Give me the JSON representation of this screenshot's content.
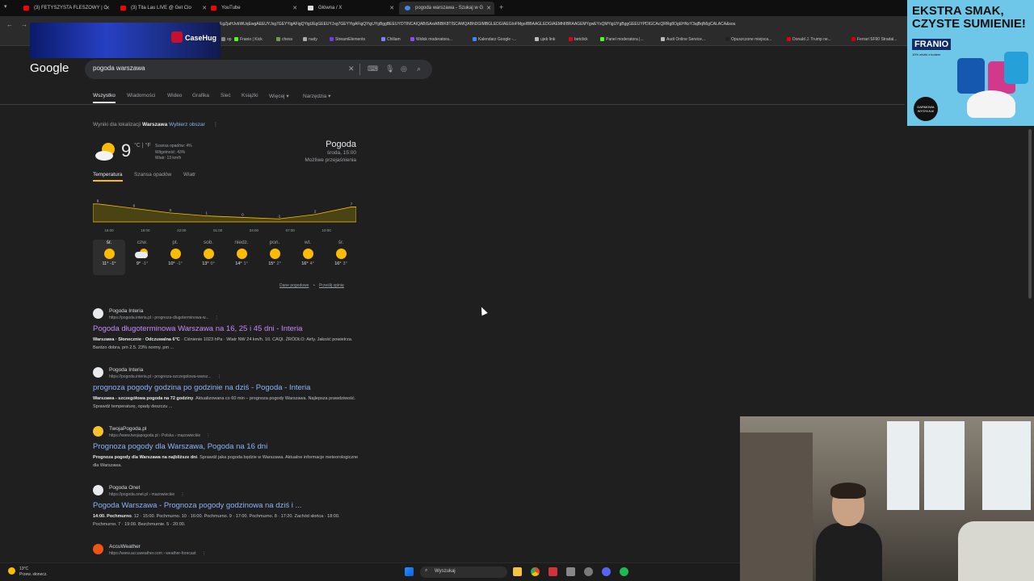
{
  "tabs": [
    {
      "label": "(3) FETYSZYSTA FLESZOWY | C",
      "color": "#ff0000"
    },
    {
      "label": "(3) Tita Lau LIVE @ Get Clo",
      "color": "#ff0000"
    },
    {
      "label": "YouTube",
      "color": "#ff0000"
    },
    {
      "label": "Główna / X",
      "color": "#ffffff"
    },
    {
      "label": "pogoda warszawa - Szukaj w G",
      "color": "#4285f4"
    }
  ],
  "tab_new": "+",
  "address": {
    "url": "EgZjaHJvbWUqEwgAEEUYJxg7GEYYigAFigQYigUEgGEEUYJxg7GEYYigAFigQYigUYgBggBEEUYOTINCAIQABiSAxiABBIK8TISCAMQABhDGIMBGLEDGIAEGIoFMgoIBBAAGLEDGIAEMhIIBRAAGEMYgwEYsQMYigUYgBggGEEUYPDIGCAcQRRg8OgEHNzY3ajBqN6gCALACA&sou"
  },
  "casehug": {
    "label": "CaseHug"
  },
  "bookmarks": [
    {
      "label": "op",
      "color": "#888"
    },
    {
      "label": "Franio | Kick",
      "color": "#53fc18"
    },
    {
      "label": "chess",
      "color": "#769656"
    },
    {
      "label": "nudy",
      "color": "#aaaaaa"
    },
    {
      "label": "StreamElements",
      "color": "#6e3ce8"
    },
    {
      "label": "Chillam",
      "color": "#7f7fff"
    },
    {
      "label": "Widok moderatora...",
      "color": "#9146ff"
    },
    {
      "label": "Kalendarz Google -...",
      "color": "#4285f4"
    },
    {
      "label": "ujeb link",
      "color": "#bbbbbb"
    },
    {
      "label": "betclick",
      "color": "#e2001a"
    },
    {
      "label": "Panel moderatora |...",
      "color": "#53fc18"
    },
    {
      "label": "Audi Online Service...",
      "color": "#bbbbbb"
    },
    {
      "label": "Opuszczone miejsca...",
      "color": "#222222"
    },
    {
      "label": "Donald J. Trump ne...",
      "color": "#e2001a"
    },
    {
      "label": "Ferrari SF90 Stradal...",
      "color": "#d40000"
    }
  ],
  "google": {
    "logo": "Google"
  },
  "search": {
    "value": "pogoda warszawa",
    "placeholder": ""
  },
  "filters": [
    "Wszystko",
    "Wiadomości",
    "Wideo",
    "Grafika",
    "Sieć",
    "Książki",
    "Więcej",
    "Narzędzia"
  ],
  "location": {
    "prefix": "Wyniki dla lokalizacji",
    "city": "Warszawa",
    "link": "Wybierz obszar"
  },
  "weather": {
    "temp": "9",
    "units": "°C | °F",
    "details": [
      "Szansa opadów: 4%",
      "Wilgotność: 43%",
      "Wiatr: 13 km/h"
    ],
    "title": "Pogoda",
    "day_time": "środa, 15:00",
    "condition": "Możliwe przejaśnienia",
    "tabs": [
      "Temperatura",
      "Szansa opadów",
      "Wiatr"
    ],
    "links": [
      "Dane pogodowe",
      "Prześlij opinię"
    ],
    "separator": "•"
  },
  "chart_data": {
    "type": "area",
    "x": [
      "16:00",
      "19:00",
      "22:00",
      "01:00",
      "04:00",
      "07:00",
      "10:00",
      "13:00"
    ],
    "values": [
      9,
      6,
      3,
      1,
      0,
      -1,
      2,
      7
    ],
    "series": [
      {
        "values": [
          9,
          6,
          3,
          1,
          0,
          -1,
          2,
          7
        ]
      }
    ],
    "ylim": [
      -3,
      11
    ],
    "color": "#fbbc04"
  },
  "days": [
    {
      "name": "śr.",
      "icon": "sun",
      "hi": "11°",
      "lo": "-1°"
    },
    {
      "name": "czw.",
      "icon": "cloud",
      "hi": "9°",
      "lo": "-1°"
    },
    {
      "name": "pt.",
      "icon": "sun",
      "hi": "10°",
      "lo": "-1°"
    },
    {
      "name": "sob.",
      "icon": "sun",
      "hi": "13°",
      "lo": "0°"
    },
    {
      "name": "niedz.",
      "icon": "sun",
      "hi": "14°",
      "lo": "1°"
    },
    {
      "name": "pon.",
      "icon": "sun",
      "hi": "15°",
      "lo": "2°"
    },
    {
      "name": "wt.",
      "icon": "sun",
      "hi": "16°",
      "lo": "4°"
    },
    {
      "name": "śr.",
      "icon": "sun",
      "hi": "16°",
      "lo": "3°"
    }
  ],
  "results": [
    {
      "site": "Pogoda Interia",
      "url": "https://pogoda.interia.pl › prognoza-dlugoterminowa-w...",
      "title": "Pogoda długoterminowa Warszawa na 16, 25 i 45 dni - Interia",
      "visited": true,
      "snippet_bold": "Warszawa · Słonecznie · Odczuwalna 6°C",
      "snippet": " · Ciśnienie 1023 hPa · Wiatr NW 24 km/h. 10. CAQI. ŹRÓDŁO: Airly. Jakość powietrza. Bardzo dobra. pm 2.5. 23% normy. pm ..."
    },
    {
      "site": "Pogoda Interia",
      "url": "https://pogoda.interia.pl › prognoza-szczegolowa-warsz...",
      "title": "prognoza pogody godzina po godzinie na dziś - Pogoda - Interia",
      "visited": false,
      "snippet_bold": "Warszawa - szczegółowa pogoda na 72 godziny",
      "snippet": ". Aktualizowana co 60 min – prognoza pogody Warszawa. Najlepsza prawdziwość. Sprawdź temperaturę, opady deszczu ..."
    },
    {
      "site": "TwojaPogoda.pl",
      "url": "https://www.twojapogoda.pl › Polska › mazowieckie",
      "title": "Prognoza pogody dla Warszawa, Pogoda na 16 dni",
      "visited": false,
      "snippet_bold": "Prognoza pogody dla Warszawa na najbliższe dni",
      "snippet": ". Sprawdź jaka pogoda będzie w Warszawa. Aktualne informacje meteorologiczne dla Warszawa."
    },
    {
      "site": "Pogoda Onet",
      "url": "https://pogoda.onet.pl › mazowieckie",
      "title": "Pogoda Warszawa - Prognoza pogody godzinowa na dziś i ...",
      "visited": false,
      "snippet_bold": "14:00. Pochmurno",
      "snippet": ". 12 · 15:00. Pochmurno. 10 · 16:00. Pochmurno. 9 · 17:00. Pochmurno. 8 · 17:20. Zachód słońca · 18:00. Pochmurno. 7 · 19:00. Bezchmurnie. 5 · 20:00."
    },
    {
      "site": "AccuWeather",
      "url": "https://www.accuweather.com › weather-forecast",
      "title": "",
      "visited": false,
      "snippet_bold": "",
      "snippet": ""
    }
  ],
  "ad": {
    "headline": "EKSTRA SMAK, CZYSTE SUMIENIE!",
    "brand": "FRANIO",
    "sub": "10% zniżki z kodem",
    "badge": "DARMOWA WYSYŁKA!"
  },
  "taskbar": {
    "temp": "13°C",
    "cond": "Przew. słonecz.",
    "search": "Wyszukaj"
  },
  "colors": {
    "link": "#8ab4f8",
    "visited": "#c58af9",
    "bg": "#1f1f1f",
    "accent": "#fbbc04"
  }
}
